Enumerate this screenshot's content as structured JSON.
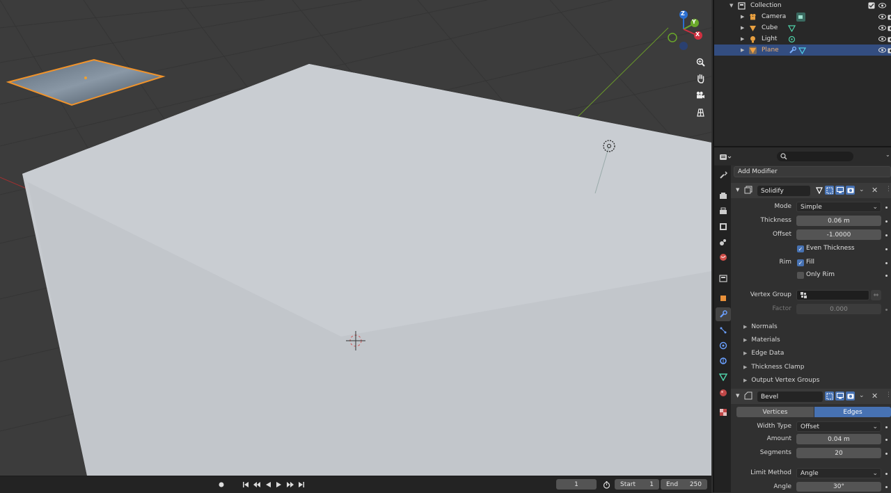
{
  "outliner": {
    "collection": "Collection",
    "items": [
      {
        "name": "Camera",
        "icon": "camera-icon",
        "selected": false
      },
      {
        "name": "Cube",
        "icon": "mesh-icon",
        "selected": false
      },
      {
        "name": "Light",
        "icon": "light-icon",
        "selected": false
      },
      {
        "name": "Plane",
        "icon": "mesh-icon",
        "selected": true
      }
    ]
  },
  "properties": {
    "add_modifier": "Add Modifier",
    "solidify": {
      "name": "Solidify",
      "mode_label": "Mode",
      "mode_value": "Simple",
      "thickness_label": "Thickness",
      "thickness_value": "0.06 m",
      "offset_label": "Offset",
      "offset_value": "-1.0000",
      "even_thickness": "Even Thickness",
      "rim_label": "Rim",
      "fill": "Fill",
      "only_rim": "Only Rim",
      "vertex_group_label": "Vertex Group",
      "factor_label": "Factor",
      "factor_value": "0.000",
      "subpanels": [
        "Normals",
        "Materials",
        "Edge Data",
        "Thickness Clamp",
        "Output Vertex Groups"
      ]
    },
    "bevel": {
      "name": "Bevel",
      "tab_vertices": "Vertices",
      "tab_edges": "Edges",
      "width_type_label": "Width Type",
      "width_type_value": "Offset",
      "amount_label": "Amount",
      "amount_value": "0.04 m",
      "segments_label": "Segments",
      "segments_value": "20",
      "limit_method_label": "Limit Method",
      "limit_method_value": "Angle",
      "angle_label": "Angle",
      "angle_value": "30°"
    }
  },
  "timeline": {
    "current_frame": "1",
    "start_label": "Start",
    "start_value": "1",
    "end_label": "End",
    "end_value": "250"
  },
  "gizmo": {
    "z": "Z",
    "y": "Y",
    "x": "X"
  },
  "colors": {
    "accent_blue": "#4772b3",
    "selection_orange": "#f0932b",
    "cube_surface": "#c9cdd2",
    "viewport_bg": "#3c3c3c"
  }
}
